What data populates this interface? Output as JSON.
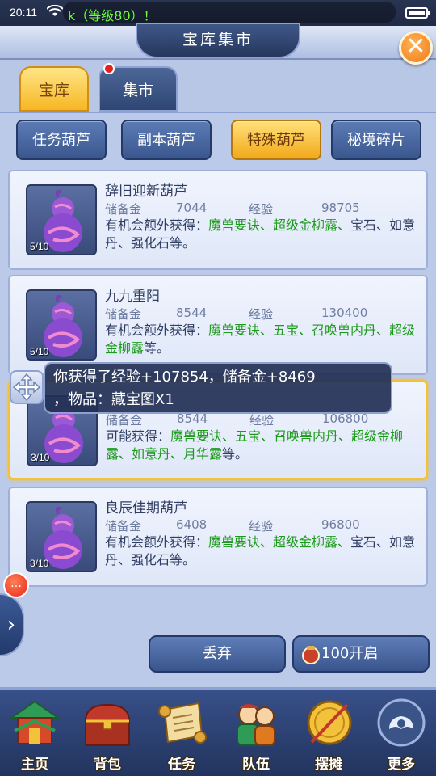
{
  "status_bar": {
    "time": "20:11",
    "ticker": "k（等级80）！",
    "wifi_icon": "wifi-icon",
    "battery_icon": "battery-icon"
  },
  "header": {
    "title": "宝库集市",
    "close_icon": "close-icon"
  },
  "tabs": [
    {
      "label": "宝库",
      "active": true
    },
    {
      "label": "集市",
      "active": false,
      "has_notification": true
    }
  ],
  "filters": [
    {
      "label": "任务葫芦",
      "active": false
    },
    {
      "label": "副本葫芦",
      "active": false
    },
    {
      "label": "特殊葫芦",
      "active": true
    },
    {
      "label": "秘境碎片",
      "active": false
    }
  ],
  "stat_labels": {
    "reserve": "储备金",
    "exp": "经验"
  },
  "items": [
    {
      "name": "辞旧迎新葫芦",
      "count": "5/10",
      "reserve": "7044",
      "exp": "98705",
      "desc_prefix": "有机会额外获得：",
      "desc_highlight": "魔兽要诀、超级金柳露、",
      "desc_suffix": "宝石、如意丹、强化石等。"
    },
    {
      "name": "九九重阳",
      "count": "5/10",
      "reserve": "8544",
      "exp": "130400",
      "desc_prefix": "有机会额外获得：",
      "desc_highlight": "魔兽要诀、五宝、召唤兽内丹、超级金柳露",
      "desc_suffix": "等。"
    },
    {
      "name": "",
      "count": "3/10",
      "reserve": "8544",
      "exp": "106800",
      "desc_prefix": "可能获得：",
      "desc_highlight": "魔兽要诀、五宝、召唤兽内丹、超级金柳露、如意丹、月华露",
      "desc_suffix": "等。",
      "selected": true
    },
    {
      "name": "良辰佳期葫芦",
      "count": "3/10",
      "reserve": "6408",
      "exp": "96800",
      "desc_prefix": "有机会额外获得：",
      "desc_highlight": "魔兽要诀、超级金柳露、",
      "desc_suffix": "宝石、如意丹、强化石等。"
    }
  ],
  "toast": {
    "line1": "你获得了经验+107854，储备金+8469",
    "line2": "，物品：藏宝图X1"
  },
  "side": {
    "badge": "…",
    "expand_icon": "chevron-right-icon"
  },
  "actions": {
    "discard": "丢弃",
    "open": "100开启"
  },
  "bottom_nav": [
    {
      "label": "主页",
      "icon": "home-pagoda-icon"
    },
    {
      "label": "背包",
      "icon": "treasure-chest-icon"
    },
    {
      "label": "任务",
      "icon": "scroll-icon"
    },
    {
      "label": "队伍",
      "icon": "team-icon"
    },
    {
      "label": "摆摊",
      "icon": "coin-icon"
    },
    {
      "label": "更多",
      "icon": "more-cloud-icon"
    }
  ]
}
